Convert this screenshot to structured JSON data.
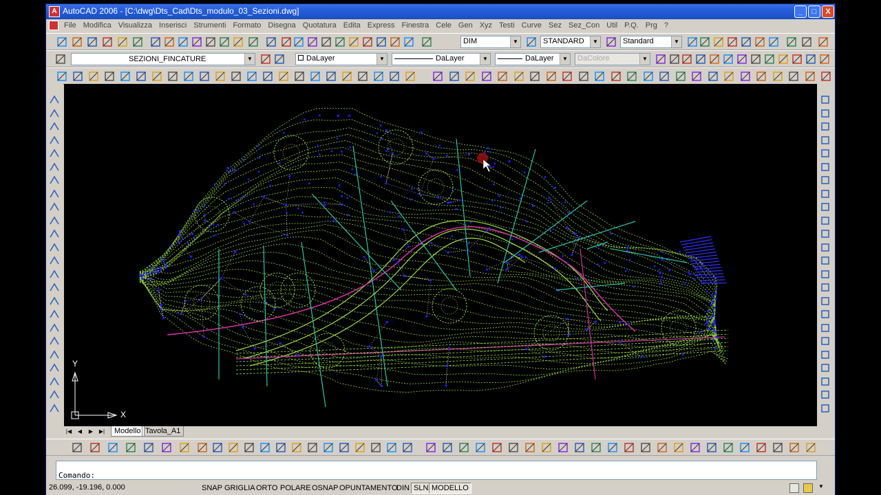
{
  "window": {
    "title": "AutoCAD 2006 - [C:\\dwg\\Dts_Cad\\Dts_modulo_03_Sezioni.dwg]",
    "minimize": "_",
    "maximize": "□",
    "close": "X"
  },
  "menu": [
    "File",
    "Modifica",
    "Visualizza",
    "Inserisci",
    "Strumenti",
    "Formato",
    "Disegna",
    "Quotatura",
    "Edita",
    "Express",
    "Finestra",
    "Cele",
    "Gen",
    "Xyz",
    "Testi",
    "Curve",
    "Sez",
    "Sez_Con",
    "Util",
    "P.Q.",
    "Prg",
    "?"
  ],
  "toolbar1": {
    "dimstyle": "DIM",
    "textstyle": "STANDARD",
    "tablestyle": "Standard"
  },
  "toolbar2": {
    "layer": "SEZIONI_FINCATURE",
    "color": "DaLayer",
    "linetype": "DaLayer",
    "lineweight": "DaLayer",
    "plotstyle": "DaColore"
  },
  "tabs": {
    "model": "Modello",
    "layout": "Tavola_A1"
  },
  "ucs": {
    "x": "X",
    "y": "Y"
  },
  "command": {
    "prompt": "Comando:"
  },
  "status": {
    "coords": "26.099, -19.196, 0.000",
    "snap": "SNAP",
    "grid": "GRIGLIA",
    "ortho": "ORTO",
    "polar": "POLARE",
    "osnap": "OSNAP",
    "otrack": "OPUNTAMENTO",
    "din": "DIN",
    "lwt": "SLN",
    "model": "MODELLO"
  },
  "colors": {
    "contours": "#9de04a",
    "points": "#2020ff",
    "sections": "#2dc4a8",
    "axis": "#d030a0",
    "highlight": "#3030ff"
  }
}
